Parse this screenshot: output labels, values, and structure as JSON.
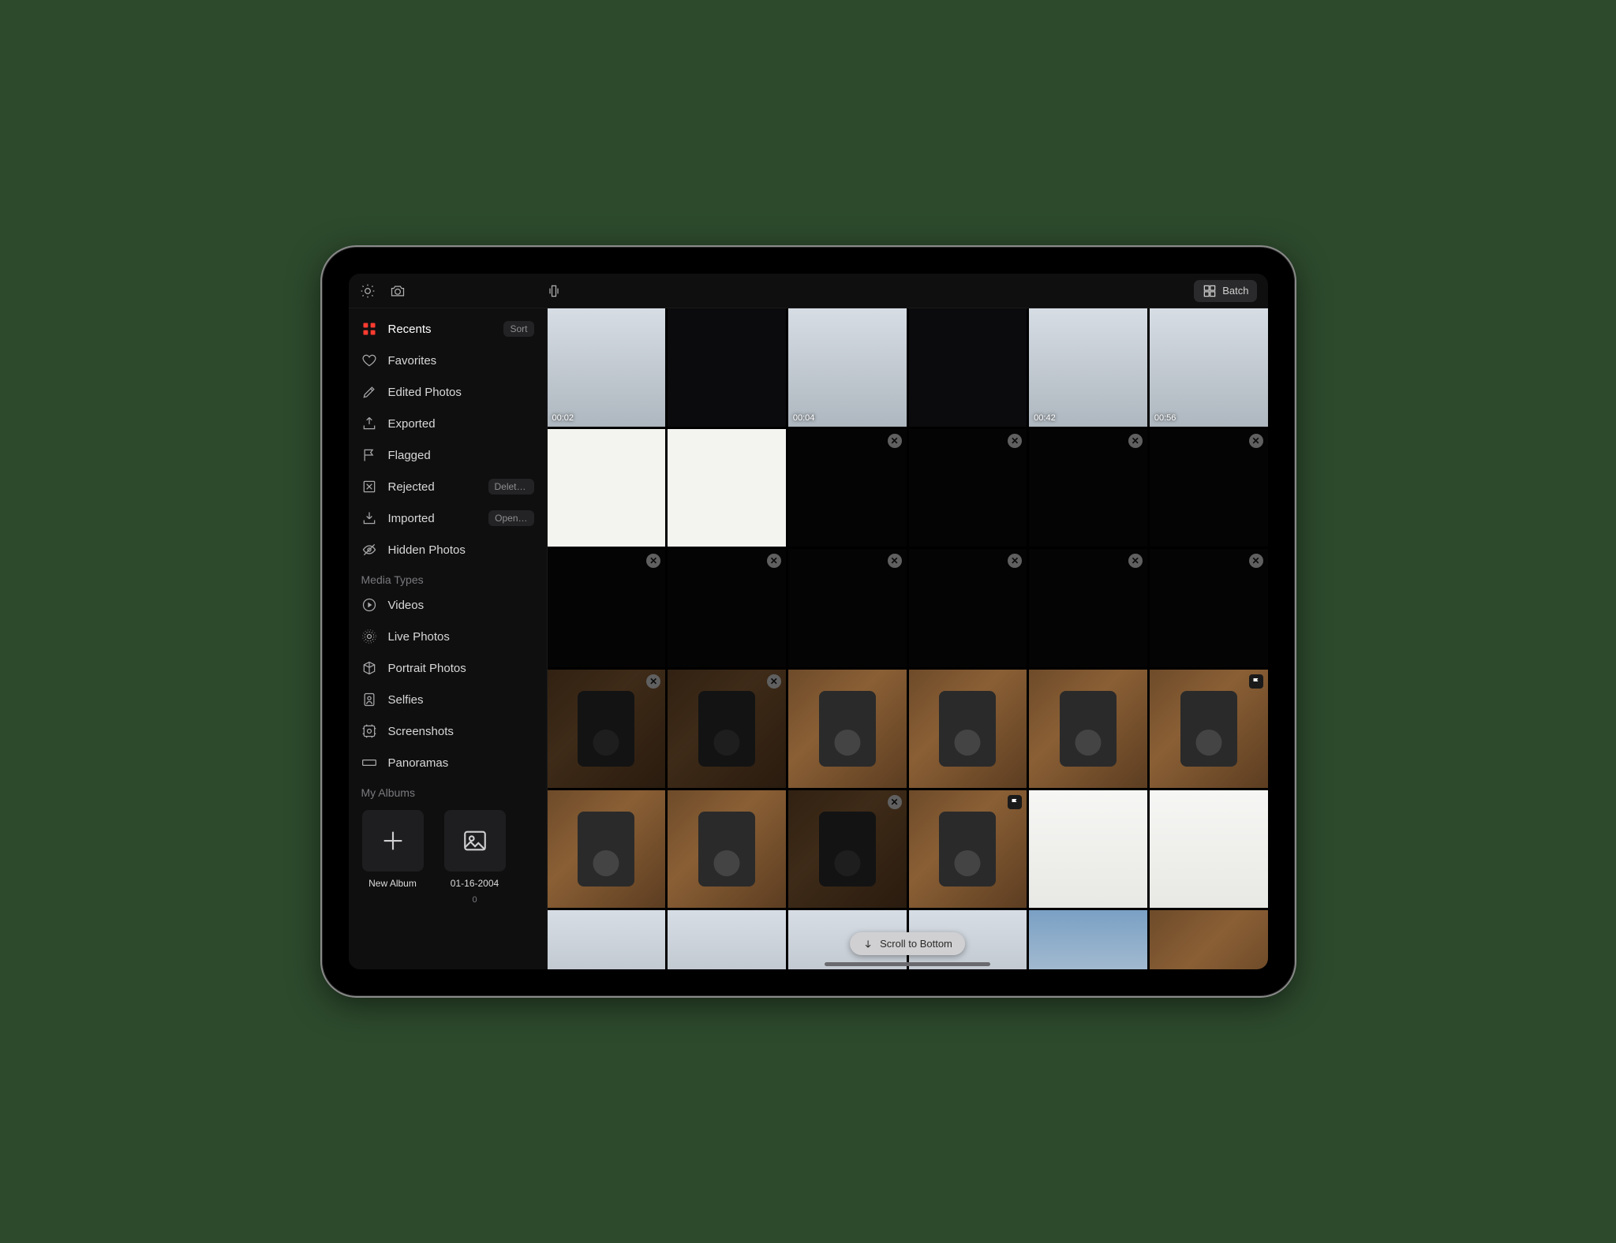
{
  "topbar": {
    "batch_label": "Batch"
  },
  "sidebar": {
    "items": [
      {
        "icon": "grid",
        "label": "Recents",
        "trailing": "Sort",
        "active": true
      },
      {
        "icon": "heart",
        "label": "Favorites"
      },
      {
        "icon": "pencil",
        "label": "Edited Photos"
      },
      {
        "icon": "export",
        "label": "Exported"
      },
      {
        "icon": "flag",
        "label": "Flagged"
      },
      {
        "icon": "reject",
        "label": "Rejected",
        "trailing": "Delete…"
      },
      {
        "icon": "import",
        "label": "Imported",
        "trailing": "Open…"
      },
      {
        "icon": "eye-off",
        "label": "Hidden Photos"
      }
    ],
    "media_types_label": "Media Types",
    "media_types": [
      {
        "icon": "play",
        "label": "Videos"
      },
      {
        "icon": "live",
        "label": "Live Photos"
      },
      {
        "icon": "cube",
        "label": "Portrait Photos"
      },
      {
        "icon": "person",
        "label": "Selfies"
      },
      {
        "icon": "screenshot",
        "label": "Screenshots"
      },
      {
        "icon": "pano",
        "label": "Panoramas"
      }
    ],
    "my_albums_label": "My Albums",
    "albums": [
      {
        "icon": "plus",
        "title": "New Album"
      },
      {
        "icon": "picture",
        "title": "01-16-2004",
        "subtitle": "0"
      }
    ]
  },
  "grid": {
    "scroll_label": "Scroll to Bottom",
    "cells": [
      {
        "style": "snow",
        "duration": "00:02"
      },
      {
        "style": "dark"
      },
      {
        "style": "snow",
        "duration": "00:04"
      },
      {
        "style": "dark"
      },
      {
        "style": "snow",
        "duration": "00:42"
      },
      {
        "style": "snow",
        "duration": "00:56"
      },
      {
        "style": "light"
      },
      {
        "style": "light"
      },
      {
        "style": "dark",
        "rejected": true
      },
      {
        "style": "dark",
        "rejected": true
      },
      {
        "style": "dark",
        "rejected": true
      },
      {
        "style": "dark",
        "rejected": true
      },
      {
        "style": "dark",
        "rejected": true
      },
      {
        "style": "dark",
        "rejected": true
      },
      {
        "style": "dark",
        "rejected": true
      },
      {
        "style": "dark",
        "rejected": true
      },
      {
        "style": "dark",
        "rejected": true
      },
      {
        "style": "dark",
        "rejected": true
      },
      {
        "style": "wood",
        "rejected": true,
        "ipod": true
      },
      {
        "style": "wood",
        "rejected": true,
        "ipod": true
      },
      {
        "style": "wood",
        "ipod": true
      },
      {
        "style": "wood",
        "ipod": true
      },
      {
        "style": "wood",
        "ipod": true
      },
      {
        "style": "wood",
        "flagged": true,
        "ipod": true
      },
      {
        "style": "wood",
        "ipod": true
      },
      {
        "style": "wood",
        "ipod": true
      },
      {
        "style": "wood",
        "rejected": true,
        "ipod": true
      },
      {
        "style": "wood",
        "flagged": true,
        "ipod": true
      },
      {
        "style": "wire"
      },
      {
        "style": "wire"
      },
      {
        "style": "snow"
      },
      {
        "style": "snow"
      },
      {
        "style": "snow"
      },
      {
        "style": "snow"
      },
      {
        "style": "sky"
      },
      {
        "style": "wood"
      }
    ]
  }
}
